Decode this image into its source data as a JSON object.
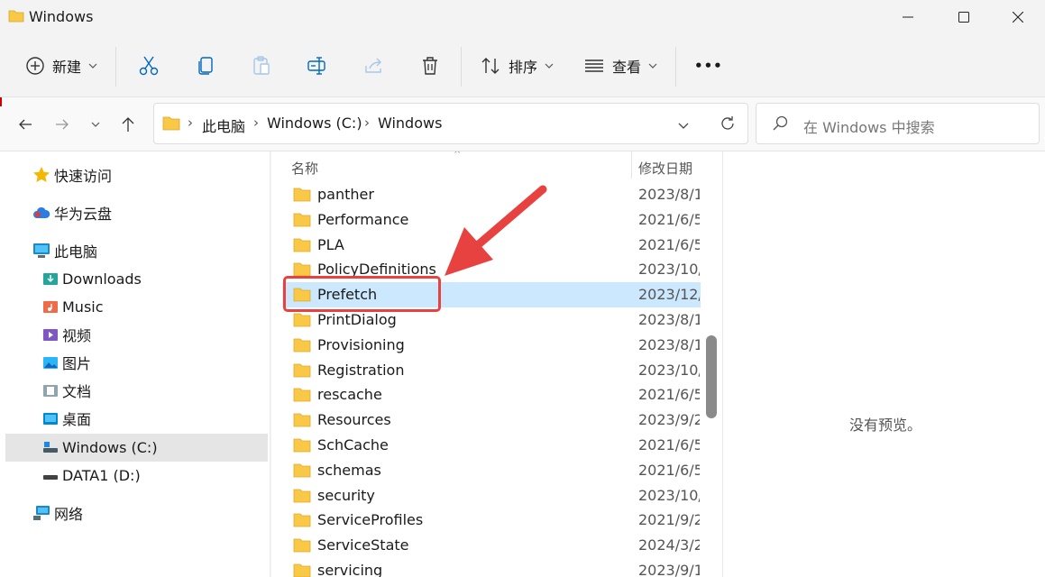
{
  "window": {
    "title": "Windows"
  },
  "toolbar": {
    "new_label": "新建",
    "sort_label": "排序",
    "view_label": "查看",
    "more_label": "•••"
  },
  "address": {
    "crumbs": [
      "此电脑",
      "Windows (C:)",
      "Windows"
    ],
    "search_placeholder": "在 Windows 中搜索"
  },
  "sidebar": {
    "items": [
      {
        "label": "快速访问",
        "icon": "star-icon"
      },
      {
        "label": "华为云盘",
        "icon": "cloud-icon"
      },
      {
        "label": "此电脑",
        "icon": "computer-icon"
      },
      {
        "label": "Downloads",
        "icon": "downloads-icon"
      },
      {
        "label": "Music",
        "icon": "music-icon"
      },
      {
        "label": "视频",
        "icon": "video-icon"
      },
      {
        "label": "图片",
        "icon": "pictures-icon"
      },
      {
        "label": "文档",
        "icon": "documents-icon"
      },
      {
        "label": "桌面",
        "icon": "desktop-icon"
      },
      {
        "label": "Windows (C:)",
        "icon": "drive-icon"
      },
      {
        "label": "DATA1 (D:)",
        "icon": "drive-icon"
      },
      {
        "label": "网络",
        "icon": "network-icon"
      }
    ]
  },
  "columns": {
    "name": "名称",
    "date": "修改日期"
  },
  "files": [
    {
      "name": "panther",
      "date": "2023/8/1"
    },
    {
      "name": "Performance",
      "date": "2021/6/5"
    },
    {
      "name": "PLA",
      "date": "2021/6/5"
    },
    {
      "name": "PolicyDefinitions",
      "date": "2023/10/"
    },
    {
      "name": "Prefetch",
      "date": "2023/12/"
    },
    {
      "name": "PrintDialog",
      "date": "2023/8/1"
    },
    {
      "name": "Provisioning",
      "date": "2023/8/1"
    },
    {
      "name": "Registration",
      "date": "2023/10/"
    },
    {
      "name": "rescache",
      "date": "2021/6/5"
    },
    {
      "name": "Resources",
      "date": "2023/9/2"
    },
    {
      "name": "SchCache",
      "date": "2021/6/5"
    },
    {
      "name": "schemas",
      "date": "2021/6/5"
    },
    {
      "name": "security",
      "date": "2023/10/"
    },
    {
      "name": "ServiceProfiles",
      "date": "2021/9/2"
    },
    {
      "name": "ServiceState",
      "date": "2024/3/2"
    },
    {
      "name": "servicing",
      "date": "2023/9/1"
    }
  ],
  "preview": {
    "text": "没有预览。"
  },
  "colors": {
    "accent": "#0067c0",
    "selection": "#cce8ff",
    "annotation": "#e7423f",
    "folder": "#f8c846"
  }
}
